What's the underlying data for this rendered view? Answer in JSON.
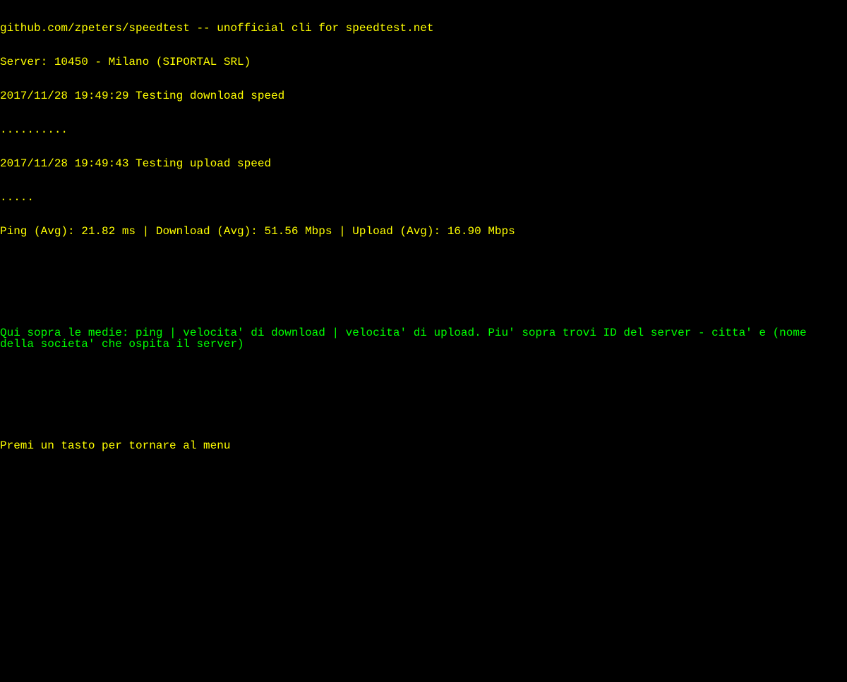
{
  "terminal": {
    "header": "github.com/zpeters/speedtest -- unofficial cli for speedtest.net",
    "server": "Server: 10450 - Milano (SIPORTAL SRL)",
    "download_test": "2017/11/28 19:49:29 Testing download speed",
    "download_dots": "..........",
    "upload_test": "2017/11/28 19:49:43 Testing upload speed",
    "upload_dots": ".....",
    "results": "Ping (Avg): 21.82 ms | Download (Avg): 51.56 Mbps | Upload (Avg): 16.90 Mbps",
    "explanation": "Qui sopra le medie: ping | velocita' di download | velocita' di upload. Piu' sopra trovi ID del server - citta' e (nome della societa' che ospita il server)",
    "prompt": "Premi un tasto per tornare al menu"
  }
}
